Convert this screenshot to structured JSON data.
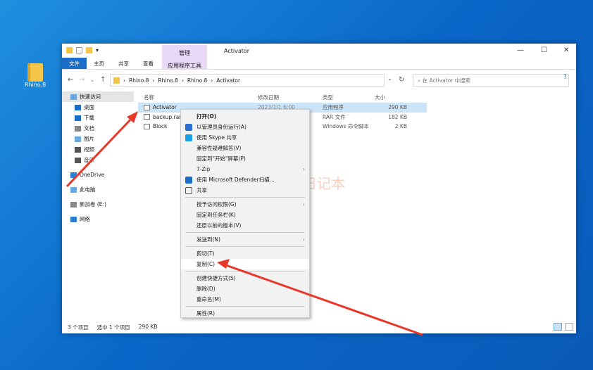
{
  "desktop": {
    "icon_label": "Rhino.8"
  },
  "window": {
    "title": "Activator",
    "context_tab": "管理",
    "context_sub": "应用程序工具",
    "tabs": [
      "文件",
      "主页",
      "共享",
      "查看"
    ],
    "controls": [
      "—",
      "☐",
      "✕"
    ],
    "breadcrumb": [
      "Rhino.8",
      "Rhino.8",
      "Rhino.8",
      "Activator"
    ],
    "search_placeholder": "在 Activator 中搜索"
  },
  "sidebar": [
    {
      "label": "快速访问",
      "type": "h"
    },
    {
      "label": "桌面"
    },
    {
      "label": "下载"
    },
    {
      "label": "文档"
    },
    {
      "label": "图片"
    },
    {
      "label": "视频"
    },
    {
      "label": "音乐"
    },
    {
      "label": "OneDrive",
      "type": "h"
    },
    {
      "label": "此电脑",
      "type": "h"
    },
    {
      "label": "新加卷 (E:)",
      "type": "h"
    },
    {
      "label": "网络",
      "type": "h"
    }
  ],
  "columns": [
    "名称",
    "修改日期",
    "类型",
    "大小"
  ],
  "files": [
    {
      "name": "Activator",
      "date": "2023/1/1 6:00",
      "type": "应用程序",
      "size": "290 KB"
    },
    {
      "name": "backup.rar",
      "date": "",
      "type": "RAR 文件",
      "size": "182 KB"
    },
    {
      "name": "Block",
      "date": "",
      "type": "Windows 命令脚本",
      "size": "2 KB"
    }
  ],
  "status": {
    "count": "3 个项目",
    "selected": "选中 1 个项目",
    "size": "290 KB"
  },
  "menu": [
    {
      "label": "打开(O)",
      "bold": true
    },
    {
      "label": "以管理员身份运行(A)",
      "icon": "shield"
    },
    {
      "label": "使用 Skype 共享",
      "icon": "skype"
    },
    {
      "label": "兼容性疑难解答(V)"
    },
    {
      "label": "固定到\"开始\"屏幕(P)"
    },
    {
      "label": "7-Zip",
      "sub": true
    },
    {
      "label": "使用 Microsoft Defender扫描...",
      "icon": "defender"
    },
    {
      "label": "共享",
      "icon": "share"
    },
    "-",
    {
      "label": "授予访问权限(G)",
      "sub": true
    },
    {
      "label": "固定到任务栏(K)"
    },
    {
      "label": "还原以前的版本(V)"
    },
    "-",
    {
      "label": "发送到(N)",
      "sub": true
    },
    "-",
    {
      "label": "剪切(T)"
    },
    {
      "label": "复制(C)",
      "hl": true
    },
    "-",
    {
      "label": "创建快捷方式(S)"
    },
    {
      "label": "删除(D)"
    },
    {
      "label": "重命名(M)"
    },
    "-",
    {
      "label": "属性(R)"
    }
  ],
  "watermark": "于同学日记本"
}
